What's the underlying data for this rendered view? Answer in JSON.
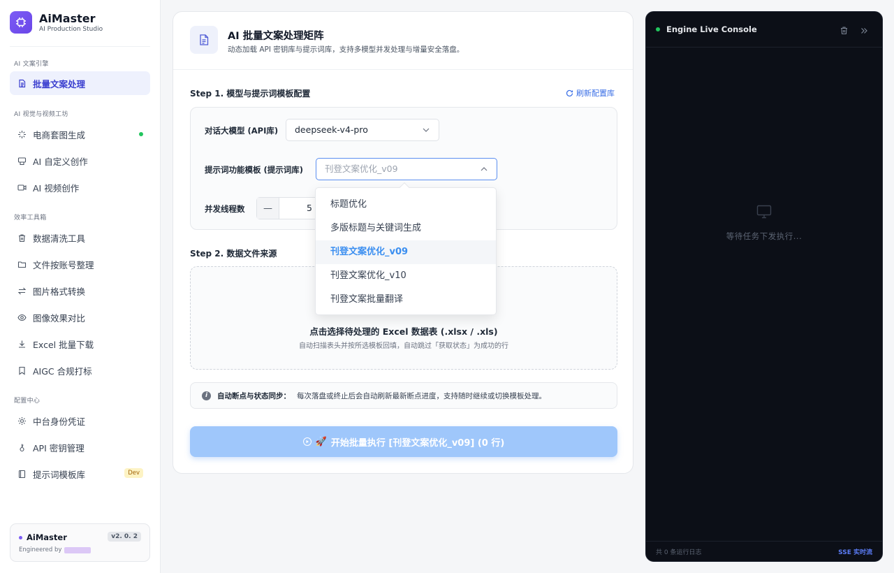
{
  "brand": {
    "name": "AiMaster",
    "tagline": "AI Production Studio"
  },
  "sidebar": {
    "sections": [
      {
        "title": "AI 文案引擎"
      },
      {
        "title": "AI 视觉与视频工坊"
      },
      {
        "title": "效率工具箱"
      },
      {
        "title": "配置中心"
      }
    ],
    "items": [
      {
        "label": "批量文案处理",
        "icon": "document-icon",
        "active": true
      },
      {
        "label": "电商套图生成",
        "icon": "sparkle-icon",
        "status": "online"
      },
      {
        "label": "AI 自定义创作",
        "icon": "palette-icon"
      },
      {
        "label": "AI 视频创作",
        "icon": "video-icon"
      },
      {
        "label": "数据清洗工具",
        "icon": "trash-icon"
      },
      {
        "label": "文件按账号整理",
        "icon": "folder-icon"
      },
      {
        "label": "图片格式转换",
        "icon": "convert-icon"
      },
      {
        "label": "图像效果对比",
        "icon": "eye-icon"
      },
      {
        "label": "Excel 批量下载",
        "icon": "download-icon"
      },
      {
        "label": "AIGC 合规打标",
        "icon": "bookmark-icon"
      },
      {
        "label": "中台身份凭证",
        "icon": "gear-icon"
      },
      {
        "label": "API 密钥管理",
        "icon": "key-icon"
      },
      {
        "label": "提示词模板库",
        "icon": "book-icon",
        "badge": "Dev"
      }
    ],
    "footer": {
      "name": "AiMaster",
      "version": "v2. 0. 2",
      "engineered_by": "Engineered by"
    }
  },
  "main": {
    "title": "AI 批量文案处理矩阵",
    "subtitle": "动态加载 API 密钥库与提示词库，支持多模型并发处理与增量安全落盘。",
    "step1": "Step 1. 模型与提示词模板配置",
    "refresh_label": "刷新配置库",
    "model_label": "对话大模型 (API库)",
    "model_value": "deepseek-v4-pro",
    "prompt_label": "提示词功能模板 (提示词库)",
    "prompt_value": "刊登文案优化_v09",
    "threads_label": "并发线程数",
    "threads_value": "5",
    "step2": "Step 2. 数据文件来源",
    "upload_title": "点击选择待处理的 Excel 数据表 (.xlsx / .xls)",
    "upload_sub": "自动扫描表头并按所选模板回填，自动跳过「获取状态」为成功的行",
    "notice_title": "自动断点与状态同步：",
    "notice_text": "每次落盘或终止后会自动刷新最新断点进度，支持随时继续或切换模板处理。",
    "run_label": "开始批量执行 [刊登文案优化_v09] (0 行)",
    "run_emoji": "🚀"
  },
  "dropdown": {
    "options": [
      "标题优化",
      "多版标题与关键词生成",
      "刊登文案优化_v09",
      "刊登文案优化_v10",
      "刊登文案批量翻译"
    ],
    "selected_index": 2
  },
  "console": {
    "title": "Engine Live Console",
    "empty_text": "等待任务下发执行...",
    "log_count": "共 0 条运行日志",
    "stream_label": "SSE 实时流"
  },
  "colors": {
    "accent": "#3a8ef0",
    "brand": "#7c5cf5",
    "online": "#22c55e",
    "console_bg": "#0c0f17"
  }
}
